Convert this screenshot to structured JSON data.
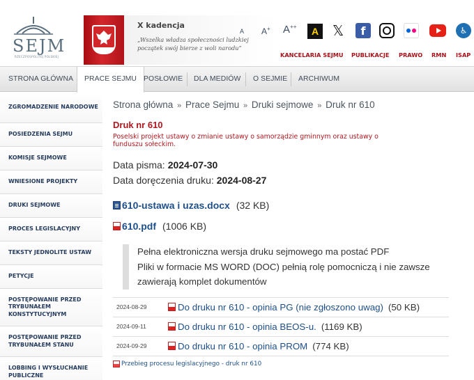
{
  "header": {
    "logo_text": "SEJM",
    "logo_sub": "RZECZPOSPOLITEJ POLSKIEJ",
    "term": "X kadencja",
    "motto": "„Wszelka władza społeczności ludzkiej początek swój bierze z woli narodu”",
    "font_sizes": [
      "A",
      "A+",
      "A++"
    ],
    "contrast_label": "A",
    "social": [
      "x-icon",
      "facebook-icon",
      "instagram-icon",
      "flickr-icon",
      "youtube-icon",
      "accessibility-icon"
    ],
    "top_links": [
      "KANCELARIA SEJMU",
      "PUBLIKACJE",
      "PRAWO",
      "RMN",
      "ISAP"
    ],
    "colors": {
      "accent": "#a4131a",
      "link": "#1d4f8a",
      "banner": "#c81e25"
    }
  },
  "nav": {
    "items": [
      "STRONA GŁÓWNA",
      "PRACE SEJMU",
      "POSŁOWIE",
      "DLA MEDIÓW",
      "O SEJMIE",
      "ARCHIWUM"
    ],
    "active": "PRACE SEJMU"
  },
  "sidebar": {
    "items": [
      "ZGROMADZENIE NARODOWE",
      "POSIEDZENIA SEJMU",
      "KOMISJE SEJMOWE",
      "WNIESIONE PROJEKTY",
      "DRUKI SEJMOWE",
      "PROCES LEGISLACYJNY",
      "TEKSTY JEDNOLITE USTAW",
      "PETYCJE",
      "POSTĘPOWANIE PRZED TRYBUNAŁEM KONSTYTUCYJNYM",
      "POSTĘPOWANIE PRZED TRYBUNAŁEM STANU",
      "LOBBING I WYSŁUCHANIE PUBLICZNE"
    ]
  },
  "content": {
    "breadcrumb": [
      "Strona główna",
      "Prace Sejmu",
      "Druki sejmowe",
      "Druk nr 610"
    ],
    "breadcrumb_sep": "»",
    "title": "Druk nr 610",
    "description": "Poselski projekt ustawy o zmianie ustawy o samorządzie gminnym oraz ustawy o funduszu sołeckim.",
    "date_label": "Data pisma:",
    "date_value": "2024-07-30",
    "delivery_label": "Data doręczenia druku:",
    "delivery_value": "2024-08-27",
    "files": [
      {
        "name": "610-ustawa i uzas.docx",
        "size": "(32 KB)",
        "type": "docx-icon"
      },
      {
        "name": "610.pdf",
        "size": "(1006 KB)",
        "type": "pdf-icon"
      }
    ],
    "note_line1": "Pełna elektroniczna wersja druku sejmowego ma postać PDF",
    "note_line2": "Pliki w formacie MS WORD (DOC) pełnią rolę pomocniczą i nie zawsze zawierają komplet dokumentów",
    "opinions": [
      {
        "date": "2024-08-29",
        "link": "Do druku nr 610 - opinia PG (nie zgłoszono uwag)",
        "size": "(50 KB)"
      },
      {
        "date": "2024-09-11",
        "link": "Do druku nr 610 - opinia BEOS-u.",
        "size": "(1169 KB)"
      },
      {
        "date": "2024-09-29",
        "link": "Do druku nr 610 - opinia PROM",
        "size": "(774 KB)"
      }
    ],
    "process_link": "Przebieg procesu legislacyjnego - druk nr 610"
  }
}
